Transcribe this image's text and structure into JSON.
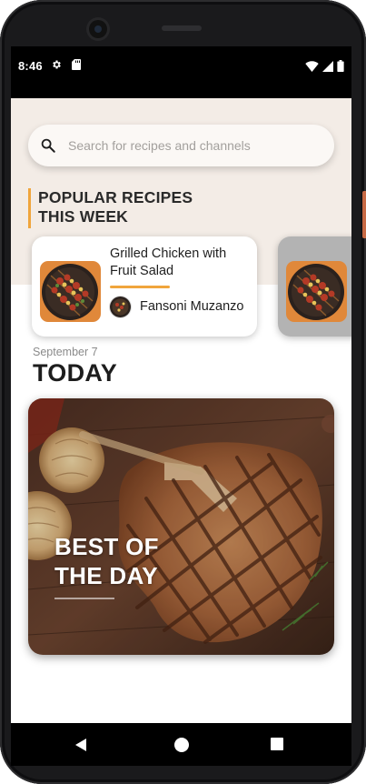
{
  "status_bar": {
    "time": "8:46",
    "icons": [
      "gear-icon",
      "sd-card-icon",
      "wifi-icon",
      "signal-icon",
      "battery-icon"
    ]
  },
  "search": {
    "placeholder": "Search for recipes and channels",
    "value": ""
  },
  "popular": {
    "title_line1": "POPULAR RECIPES",
    "title_line2": "THIS WEEK"
  },
  "recipes": [
    {
      "title": "Grilled Chicken with Fruit Salad",
      "author": "Fansoni Muzanzo"
    }
  ],
  "today": {
    "date": "September 7",
    "heading": "TODAY",
    "hero_line1": "BEST OF",
    "hero_line2": "THE DAY"
  },
  "nav": {
    "icons": [
      "back-icon",
      "home-icon",
      "recents-icon"
    ]
  },
  "colors": {
    "accent": "#f0a53c",
    "hero_background": "#f3ece6",
    "text_primary": "#1e1e1e",
    "text_secondary": "#8a8a8a",
    "placeholder": "#a3a09d"
  }
}
